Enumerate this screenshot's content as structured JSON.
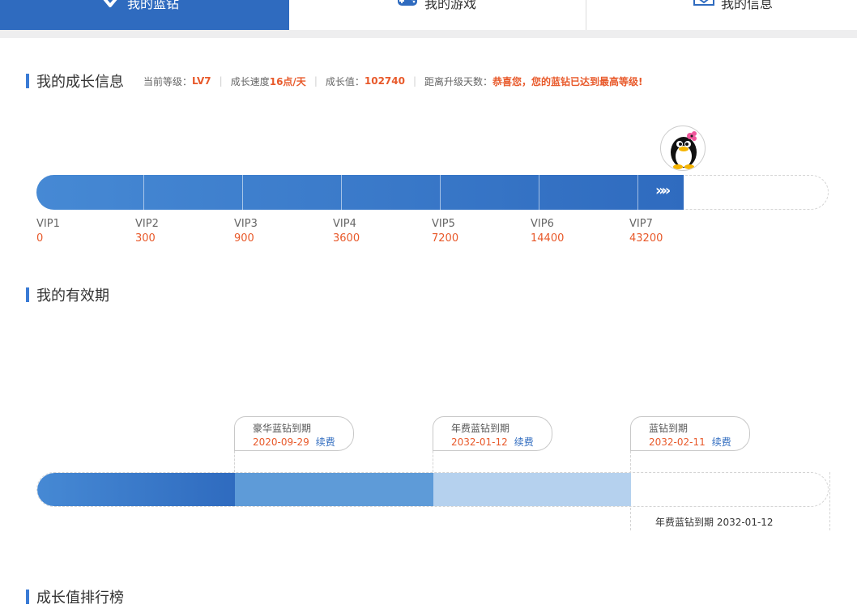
{
  "tabs": [
    {
      "label": "我的蓝钻",
      "icon": "diamond-icon",
      "active": true
    },
    {
      "label": "我的游戏",
      "icon": "gamepad-icon",
      "active": false
    },
    {
      "label": "我的信息",
      "icon": "envelope-icon",
      "active": false
    }
  ],
  "growth": {
    "title": "我的成长信息",
    "level_label": "当前等级：",
    "level_value": "LV7",
    "speed_label": "成长速度",
    "speed_value": "16点/天",
    "points_label": "成长值：",
    "points_value": "102740",
    "days_label": "距离升级天数：",
    "days_value": "恭喜您，您的蓝钻已达到最高等级!",
    "progress_fraction": 0.819,
    "levels": [
      {
        "name": "VIP1",
        "points": "0"
      },
      {
        "name": "VIP2",
        "points": "300"
      },
      {
        "name": "VIP3",
        "points": "900"
      },
      {
        "name": "VIP4",
        "points": "3600"
      },
      {
        "name": "VIP5",
        "points": "7200"
      },
      {
        "name": "VIP6",
        "points": "14400"
      },
      {
        "name": "VIP7",
        "points": "43200"
      }
    ],
    "arrows": "»»"
  },
  "validity": {
    "title": "我的有效期",
    "milestones": [
      {
        "title": "豪华蓝钻到期",
        "date": "2020-09-29",
        "renew": "续费"
      },
      {
        "title": "年费蓝钻到期",
        "date": "2032-01-12",
        "renew": "续费"
      },
      {
        "title": "蓝钻到期",
        "date": "2032-02-11",
        "renew": "续费"
      }
    ],
    "note": "年费蓝钻到期 2032-01-12"
  },
  "ranking": {
    "title": "成长值排行榜"
  },
  "colors": {
    "accent": "#2f6bbf",
    "highlight": "#e8592a",
    "seg1": "#2f6bbf",
    "seg2": "#5e9bd8",
    "seg3": "#b5d1ee"
  }
}
